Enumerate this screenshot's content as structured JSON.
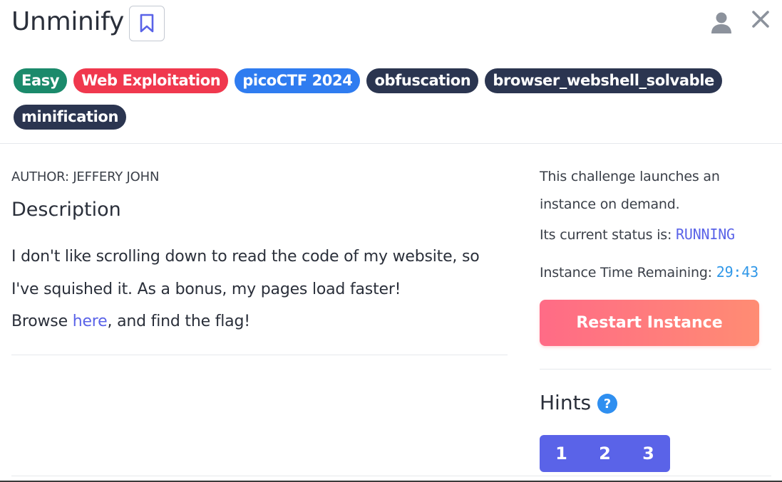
{
  "challenge": {
    "title": "Unminify",
    "tags": [
      {
        "label": "Easy",
        "color": "#1b8a6b"
      },
      {
        "label": "Web Exploitation",
        "color": "#f0384e"
      },
      {
        "label": "picoCTF 2024",
        "color": "#2f7cf0"
      },
      {
        "label": "obfuscation",
        "color": "#2b3550"
      },
      {
        "label": "browser_webshell_solvable",
        "color": "#2b3550"
      },
      {
        "label": "minification",
        "color": "#2b3550"
      }
    ],
    "author": "AUTHOR: JEFFERY JOHN",
    "description_heading": "Description",
    "description_line1": "I don't like scrolling down to read the code of my website, so",
    "description_line2": "I've squished it. As a bonus, my pages load faster!",
    "description_line3_prefix": "Browse ",
    "description_link": "here",
    "description_line3_suffix": ", and find the flag!"
  },
  "icons": {
    "bookmark": "bookmark-icon",
    "user": "user-icon",
    "close": "close-icon",
    "help": "question-circle-icon"
  },
  "instance": {
    "launch_line1": "This challenge launches an",
    "launch_line2": "instance on demand.",
    "status_label": "Its current status is: ",
    "status_value": "RUNNING",
    "time_label": "Instance Time Remaining: ",
    "time_value": "29:43",
    "restart_label": "Restart Instance"
  },
  "hints": {
    "heading": "Hints",
    "buttons": [
      "1",
      "2",
      "3"
    ]
  },
  "colors": {
    "accent": "#5a63e8",
    "restart_gradient_start": "#ff6b86",
    "restart_gradient_end": "#ff8c73",
    "timer": "#2f97e8"
  }
}
